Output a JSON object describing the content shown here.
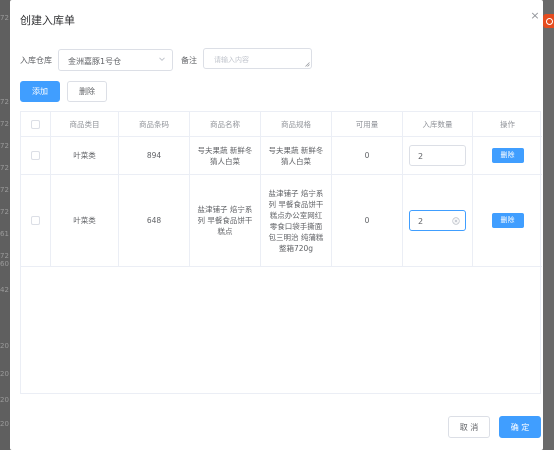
{
  "background": {
    "edge_text": [
      "72",
      "72",
      "72",
      "72",
      "72",
      "72",
      "72",
      "61",
      "72",
      "60",
      "42",
      "20",
      "20",
      "20",
      "20"
    ]
  },
  "dialog": {
    "title": "创建入库单",
    "close_symbol": "×"
  },
  "form": {
    "warehouse_label": "入库仓库",
    "warehouse_value": "金洲嘉豚1号仓",
    "remark_label": "备注",
    "remark_placeholder": "请输入内容"
  },
  "toolbar": {
    "add_label": "添加",
    "delete_label": "删除"
  },
  "table": {
    "columns": [
      "",
      "商品类目",
      "商品条码",
      "商品名称",
      "商品规格",
      "可用量",
      "入库数量",
      "操作"
    ],
    "rows": [
      {
        "category": "叶菜类",
        "barcode": "894",
        "name": "号夫果蔬 新鲜冬 猜人白菜",
        "spec": "号夫果蔬 新鲜冬 猜人白菜",
        "available": "0",
        "quantity": "2",
        "action": "删除"
      },
      {
        "category": "叶菜类",
        "barcode": "648",
        "name": "盐津铺子 焙宁系 列 早餐食品饼干 糕点",
        "spec": "盐津铺子 焙宁系 列 早餐食品饼干 糕点办公室网红 零食口袋手撕面 包三明治 纯蒲糕 整箱720g",
        "available": "0",
        "quantity": "2",
        "action": "删除"
      }
    ]
  },
  "footer": {
    "cancel_label": "取 消",
    "confirm_label": "确 定"
  },
  "colors": {
    "primary": "#409eff",
    "border": "#dcdfe6",
    "overlay": "#6b6b6b",
    "brand": "#e54c1f"
  }
}
